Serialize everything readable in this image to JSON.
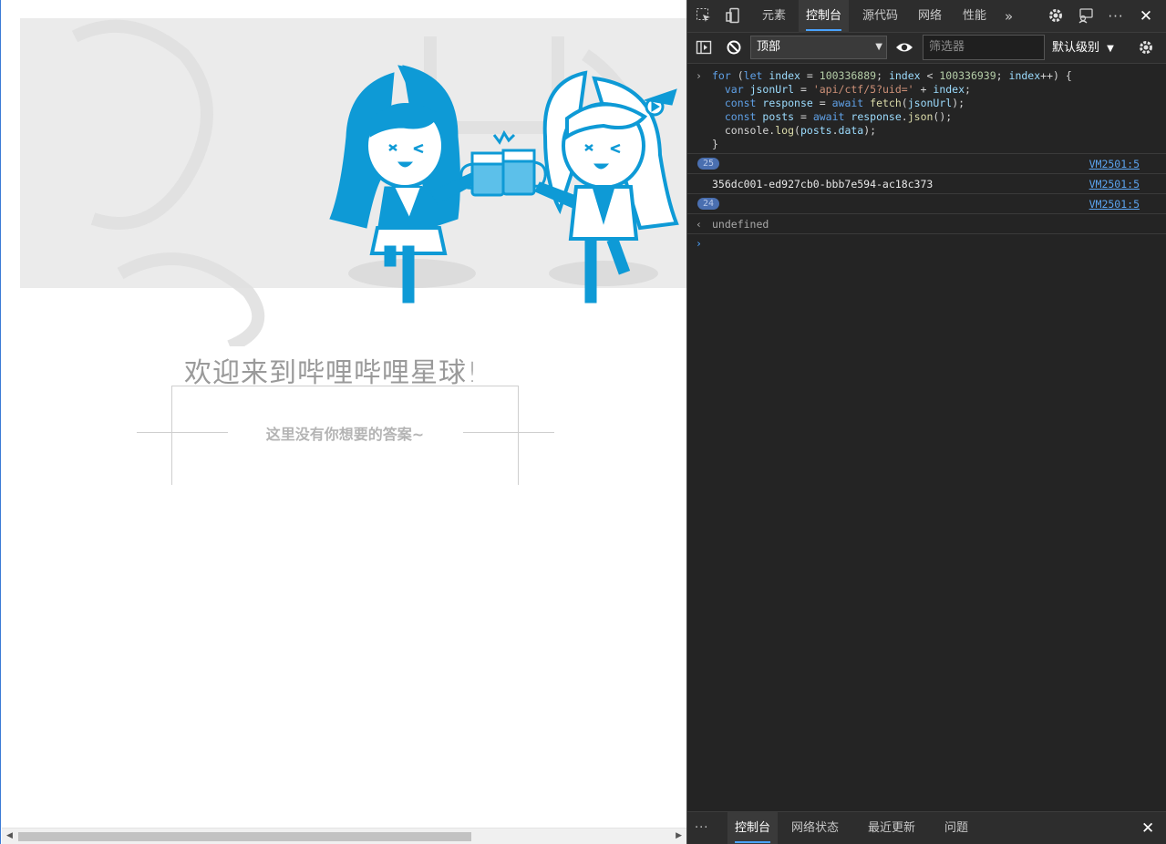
{
  "page": {
    "welcome": "欢迎来到哔哩哔哩星球!",
    "answer": "这里没有你想要的答案~"
  },
  "devtools": {
    "tabs": [
      "元素",
      "控制台",
      "源代码",
      "网络",
      "性能"
    ],
    "more_tabs": "»",
    "context": "顶部",
    "filter_placeholder": "筛选器",
    "level": "默认级别",
    "console": {
      "code_lines": [
        "for (let index = 100336889; index < 100336939; index++) {",
        "  var jsonUrl = 'api/ctf/5?uid=' + index;",
        "  const response = await fetch(jsonUrl);",
        "  const posts = await response.json();",
        "  console.log(posts.data);",
        "}"
      ],
      "rows": [
        {
          "badge": "25",
          "source": "VM2501:5"
        },
        {
          "text": "356dc001-ed927cb0-bbb7e594-ac18c373",
          "source": "VM2501:5"
        },
        {
          "badge": "24",
          "source": "VM2501:5"
        }
      ],
      "result": "undefined"
    },
    "drawer_tabs": [
      "控制台",
      "网络状态",
      "最近更新",
      "问题"
    ],
    "drawer_more": "···"
  },
  "colors": {
    "accent": "#4aa3ff",
    "mascot": "#0e9ad6",
    "devtools_bg": "#242424"
  },
  "icons": [
    "inspect-icon",
    "device-icon",
    "settings-icon",
    "feedback-icon",
    "more-icon",
    "close-icon",
    "sidebar-icon",
    "clear-icon",
    "eye-icon"
  ]
}
